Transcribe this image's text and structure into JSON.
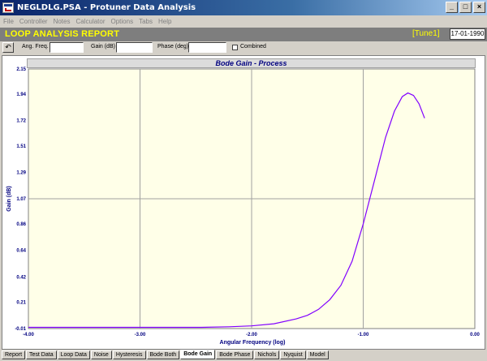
{
  "window": {
    "title": "NEGLDLG.PSA - Protuner Data  Analysis",
    "controls": [
      "_",
      "□",
      "×"
    ]
  },
  "menu": [
    "File",
    "Controller",
    "Notes",
    "Calculator",
    "Options",
    "Tabs",
    "Help"
  ],
  "report": {
    "title": "LOOP ANALYSIS REPORT",
    "tune": "[Tune1]",
    "date": "17-01-1990"
  },
  "toolbar": {
    "undo_icon": "↶",
    "ang_freq_label": "Ang. Freq.",
    "ang_freq_value": "",
    "gain_label": "Gain (dB)",
    "gain_value": "",
    "phase_label": "Phase (deg)",
    "phase_value": "",
    "combined_label": "Combined"
  },
  "chart_data": {
    "type": "line",
    "title": "Bode Gain - Process",
    "xlabel": "Angular Frequency (log)",
    "ylabel": "Gain (dB)",
    "xlim": [
      -4.0,
      0.0
    ],
    "ylim": [
      -0.01,
      2.15
    ],
    "x_ticks": [
      "-4.00",
      "-3.00",
      "-2.00",
      "-1.00",
      "0.00"
    ],
    "y_ticks": [
      "2.15",
      "1.94",
      "1.72",
      "1.51",
      "1.29",
      "1.07",
      "0.86",
      "0.64",
      "0.42",
      "0.21",
      "-0.01"
    ],
    "grid": true,
    "series": [
      {
        "color": "#8000ff",
        "x": [
          -2.45,
          -2.2,
          -2.0,
          -1.8,
          -1.6,
          -1.5,
          -1.4,
          -1.3,
          -1.2,
          -1.1,
          -1.0,
          -0.9,
          -0.8,
          -0.72,
          -0.65,
          -0.6,
          -0.55,
          -0.5,
          -0.45
        ],
        "y": [
          0.0,
          0.005,
          0.012,
          0.03,
          0.07,
          0.1,
          0.15,
          0.23,
          0.35,
          0.55,
          0.86,
          1.22,
          1.58,
          1.8,
          1.92,
          1.95,
          1.93,
          1.86,
          1.74
        ]
      }
    ]
  },
  "tabs": [
    {
      "label": "Report",
      "active": false
    },
    {
      "label": "Test Data",
      "active": false
    },
    {
      "label": "Loop Data",
      "active": false
    },
    {
      "label": "Noise",
      "active": false
    },
    {
      "label": "Hysteresis",
      "active": false
    },
    {
      "label": "Bode Both",
      "active": false
    },
    {
      "label": "Bode Gain",
      "active": true
    },
    {
      "label": "Bode Phase",
      "active": false
    },
    {
      "label": "Nichols",
      "active": false
    },
    {
      "label": "Nyquist",
      "active": false
    },
    {
      "label": "Model",
      "active": false
    }
  ]
}
